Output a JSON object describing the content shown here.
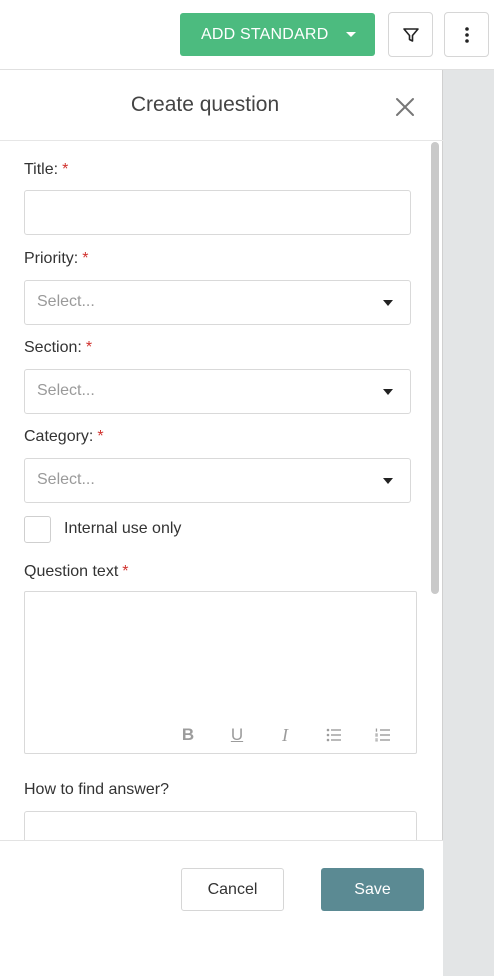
{
  "toolbar": {
    "add_standard_label": "ADD STANDARD",
    "accent_color": "#4cbb7f",
    "filter_icon": "filter-icon",
    "more_icon": "vertical-dots-icon"
  },
  "panel": {
    "title": "Create question",
    "close_icon": "close-icon"
  },
  "form": {
    "title_label": "Title:",
    "priority_label": "Priority:",
    "priority_placeholder": "Select...",
    "section_label": "Section:",
    "section_placeholder": "Select...",
    "category_label": "Category:",
    "category_placeholder": "Select...",
    "internal_use_label": "Internal use only",
    "question_text_label": "Question text",
    "required_marker": "*",
    "editor_toolbar": {
      "bold": "B",
      "underline": "U",
      "italic": "I"
    },
    "how_to_find_label": "How to find answer?"
  },
  "footer": {
    "cancel_label": "Cancel",
    "save_label": "Save",
    "save_color": "#5b8a93"
  }
}
